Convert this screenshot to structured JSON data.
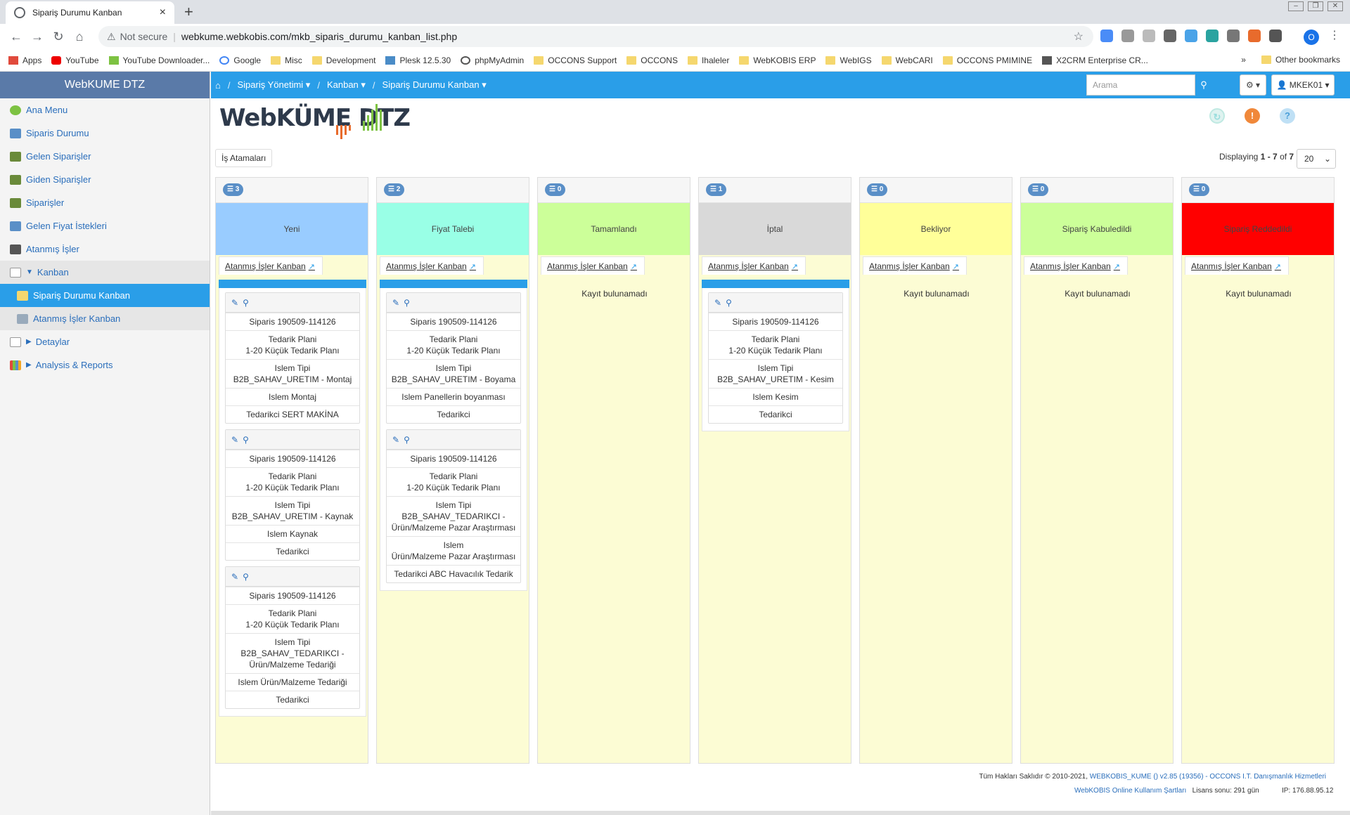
{
  "browser": {
    "tab_title": "Sipariş Durumu Kanban",
    "not_secure": "Not secure",
    "url": "webkume.webkobis.com/mkb_siparis_durumu_kanban_list.php",
    "profile_initial": "O",
    "bookmarks": [
      "Apps",
      "YouTube",
      "YouTube Downloader...",
      "Google",
      "Misc",
      "Development",
      "Plesk 12.5.30",
      "phpMyAdmin",
      "OCCONS Support",
      "OCCONS",
      "Ihaleler",
      "WebKOBIS ERP",
      "WebIGS",
      "WebCARI",
      "OCCONS PMIMINE",
      "X2CRM Enterprise CR..."
    ],
    "other_bookmarks": "Other bookmarks",
    "more": "»"
  },
  "sidebar": {
    "brand": "WebKUME DTZ",
    "items": [
      {
        "label": "Ana Menu"
      },
      {
        "label": "Siparis Durumu"
      },
      {
        "label": "Gelen Siparişler"
      },
      {
        "label": "Giden Siparişler"
      },
      {
        "label": "Siparişler"
      },
      {
        "label": "Gelen Fiyat İstekleri"
      },
      {
        "label": "Atanmış İşler"
      },
      {
        "label": "Kanban"
      },
      {
        "label": "Sipariş Durumu Kanban"
      },
      {
        "label": "Atanmış İşler Kanban"
      },
      {
        "label": "Detaylar"
      },
      {
        "label": "Analysis & Reports"
      }
    ]
  },
  "topnav": {
    "crumb1": "Sipariş Yönetimi",
    "crumb2": "Kanban",
    "crumb3": "Sipariş Durumu Kanban",
    "search_placeholder": "Arama",
    "user": "MKEK01"
  },
  "logo": {
    "text": "WebKÜME DTZ"
  },
  "toolbar": {
    "is_atamalari": "İş Atamaları",
    "displaying_prefix": "Displaying",
    "range": "1 - 7",
    "of": "of",
    "total": "7",
    "per_page": "20"
  },
  "link_label": "Atanmış İşler Kanban",
  "empty_text": "Kayıt bulunamadı",
  "colors": {
    "accent": "#2a9ee8",
    "sidebar_brand": "#5a7aa8",
    "board_bg": "#fcfcd4"
  },
  "columns": [
    {
      "title": "Yeni",
      "count": "3",
      "color": "#99ccff",
      "cards": [
        {
          "rows": [
            "Siparis 190509-114126",
            "Tedarik Plani\n1-20 Küçük Tedarik Planı",
            "Islem Tipi\nB2B_SAHAV_URETIM - Montaj",
            "Islem Montaj",
            "Tedarikci SERT MAKİNA"
          ]
        },
        {
          "rows": [
            "Siparis 190509-114126",
            "Tedarik Plani\n1-20 Küçük Tedarik Planı",
            "Islem Tipi\nB2B_SAHAV_URETIM - Kaynak",
            "Islem Kaynak",
            "Tedarikci"
          ]
        },
        {
          "rows": [
            "Siparis 190509-114126",
            "Tedarik Plani\n1-20 Küçük Tedarik Planı",
            "Islem Tipi\nB2B_SAHAV_TEDARIKCI - Ürün/Malzeme Tedariği",
            "Islem Ürün/Malzeme Tedariği",
            "Tedarikci"
          ]
        }
      ]
    },
    {
      "title": "Fiyat Talebi",
      "count": "2",
      "color": "#99ffe6",
      "cards": [
        {
          "rows": [
            "Siparis 190509-114126",
            "Tedarik Plani\n1-20 Küçük Tedarik Planı",
            "Islem Tipi\nB2B_SAHAV_URETIM - Boyama",
            "Islem Panellerin boyanması",
            "Tedarikci"
          ]
        },
        {
          "rows": [
            "Siparis 190509-114126",
            "Tedarik Plani\n1-20 Küçük Tedarik Planı",
            "Islem Tipi\nB2B_SAHAV_TEDARIKCI - Ürün/Malzeme Pazar Araştırması",
            "Islem\nÜrün/Malzeme Pazar Araştırması",
            "Tedarikci ABC Havacılık Tedarik"
          ]
        }
      ]
    },
    {
      "title": "Tamamlandı",
      "count": "0",
      "color": "#ccff99",
      "cards": []
    },
    {
      "title": "İptal",
      "count": "1",
      "color": "#d9d9d9",
      "cards": [
        {
          "rows": [
            "Siparis 190509-114126",
            "Tedarik Plani\n1-20 Küçük Tedarik Planı",
            "Islem Tipi\nB2B_SAHAV_URETIM - Kesim",
            "Islem Kesim",
            "Tedarikci"
          ]
        }
      ]
    },
    {
      "title": "Bekliyor",
      "count": "0",
      "color": "#ffff99",
      "cards": []
    },
    {
      "title": "Sipariş Kabuledildi",
      "count": "0",
      "color": "#ccff99",
      "cards": []
    },
    {
      "title": "Sipariş Reddedildi",
      "count": "0",
      "color": "#ff0000",
      "cards": []
    }
  ],
  "footer": {
    "rights": "Tüm Hakları Saklıdır © 2010-2021,",
    "version": "WEBKOBIS_KUME () v2.85 (19356) - OCCONS I.T. Danışmanlık Hizmetleri",
    "terms": "WebKOBIS Online Kullanım Şartları",
    "license": "Lisans sonu: 291 gün",
    "ip": "IP: 176.88.95.12"
  }
}
